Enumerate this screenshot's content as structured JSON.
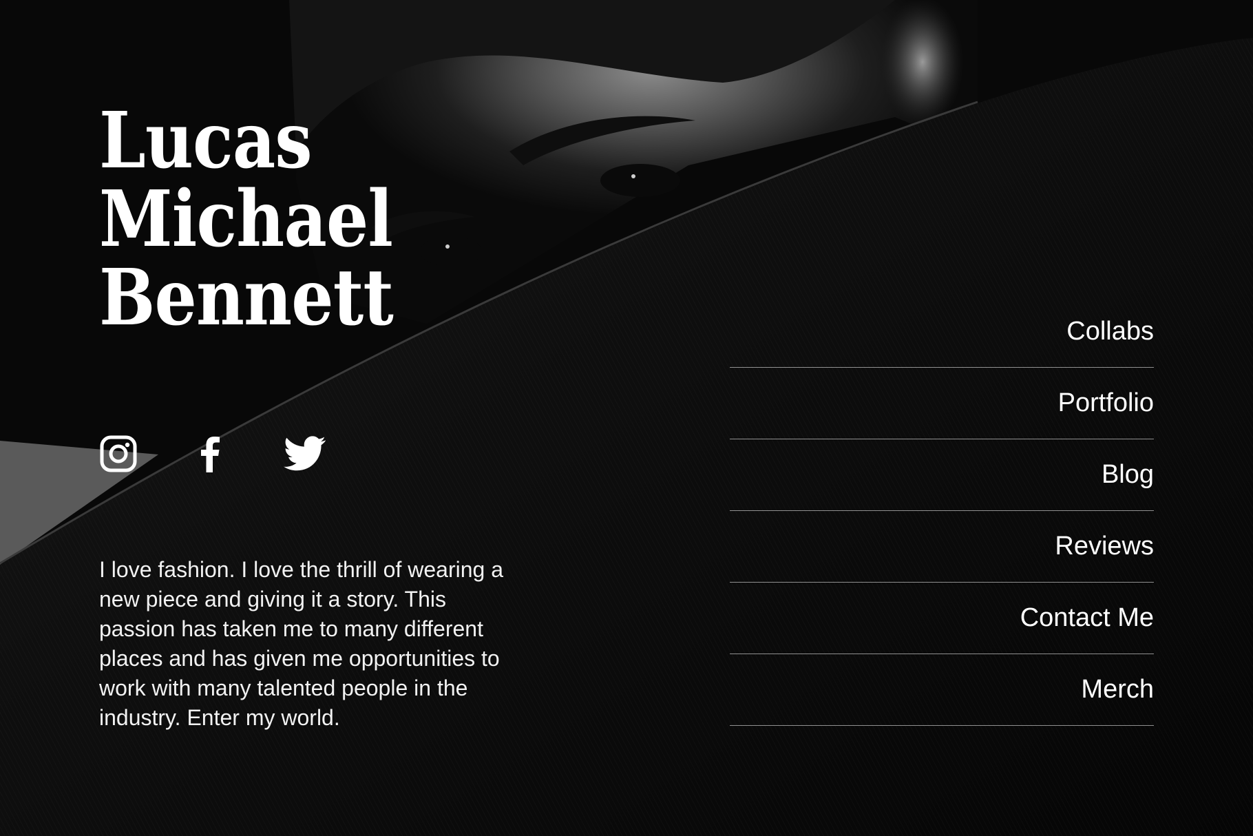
{
  "profile": {
    "name_lines": [
      "Lucas",
      "Michael",
      "Bennett"
    ],
    "bio": "I love fashion. I love the thrill of wearing a new piece and giving it a story. This passion has taken me to many different places and has given me opportunities to work with many talented people in the industry. Enter my world."
  },
  "social": [
    {
      "icon": "instagram-icon"
    },
    {
      "icon": "facebook-icon"
    },
    {
      "icon": "twitter-icon"
    }
  ],
  "nav": {
    "items": [
      {
        "label": "Collabs"
      },
      {
        "label": "Portfolio"
      },
      {
        "label": "Blog"
      },
      {
        "label": "Reviews"
      },
      {
        "label": "Contact Me"
      },
      {
        "label": "Merch"
      }
    ]
  },
  "colors": {
    "background": "#070707",
    "text": "#ffffff",
    "divider": "#8c8c8c"
  }
}
